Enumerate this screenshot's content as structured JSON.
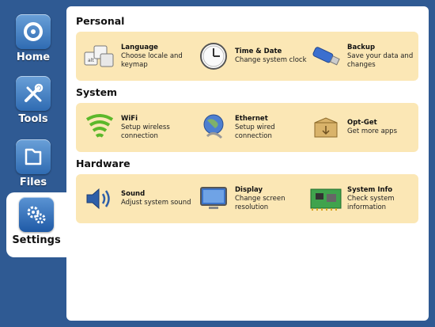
{
  "sidebar": {
    "items": [
      {
        "label": "Home",
        "icon": "home-icon"
      },
      {
        "label": "Tools",
        "icon": "tools-icon"
      },
      {
        "label": "Files",
        "icon": "files-icon"
      },
      {
        "label": "Settings",
        "icon": "settings-icon",
        "active": true
      }
    ]
  },
  "sections": {
    "personal": {
      "title": "Personal",
      "items": [
        {
          "title": "Language",
          "desc": "Choose locale and keymap",
          "icon": "keyboard-icon"
        },
        {
          "title": "Time & Date",
          "desc": "Change system clock",
          "icon": "clock-icon"
        },
        {
          "title": "Backup",
          "desc": "Save your data and changes",
          "icon": "usb-drive-icon"
        }
      ]
    },
    "system": {
      "title": "System",
      "items": [
        {
          "title": "WiFi",
          "desc": "Setup wireless connection",
          "icon": "wifi-icon"
        },
        {
          "title": "Ethernet",
          "desc": "Setup wired connection",
          "icon": "ethernet-globe-icon"
        },
        {
          "title": "Opt-Get",
          "desc": "Get more apps",
          "icon": "package-icon"
        }
      ]
    },
    "hardware": {
      "title": "Hardware",
      "items": [
        {
          "title": "Sound",
          "desc": "Adjust system sound",
          "icon": "speaker-icon"
        },
        {
          "title": "Display",
          "desc": "Change screen resolution",
          "icon": "monitor-icon"
        },
        {
          "title": "System Info",
          "desc": "Check system information",
          "icon": "circuit-board-icon"
        }
      ]
    }
  },
  "colors": {
    "background": "#2f5a93",
    "panel": "#fbe7b5",
    "accent": "#2f6bb2"
  }
}
